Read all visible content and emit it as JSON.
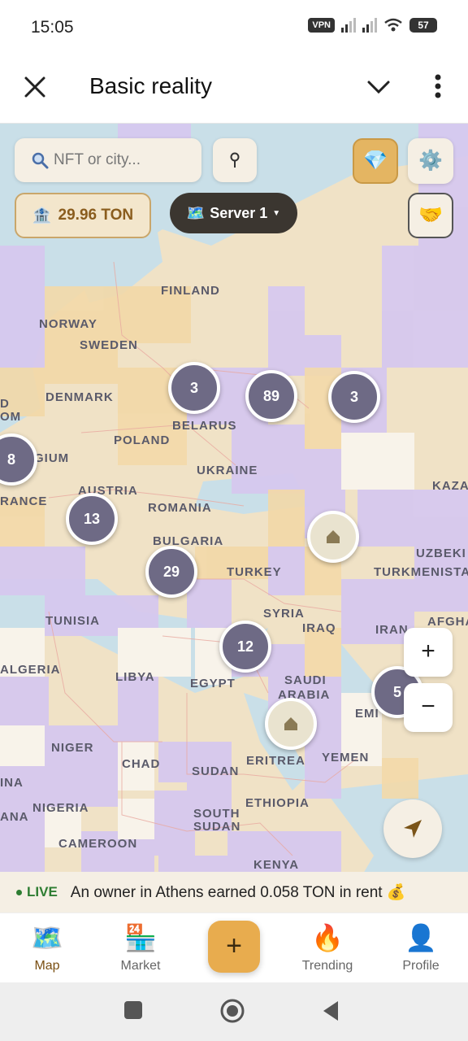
{
  "status_bar": {
    "time": "15:05",
    "vpn": "VPN",
    "battery": "57"
  },
  "app_bar": {
    "title": "Basic reality"
  },
  "map": {
    "search_placeholder": "NFT or city...",
    "balance": "29.96 TON",
    "server": "Server 1",
    "countries": [
      "FINLAND",
      "NORWAY",
      "SWEDEN",
      "DENMARK",
      "BELARUS",
      "POLAND",
      "UKRAINE",
      "AUSTRIA",
      "ROMANIA",
      "BULGARIA",
      "TURKEY",
      "TUNISIA",
      "SYRIA",
      "IRAQ",
      "IRAN",
      "ALGERIA",
      "LIBYA",
      "EGYPT",
      "SAUDI",
      "ARABIA",
      "NIGER",
      "CHAD",
      "SUDAN",
      "ERITREA",
      "YEMEN",
      "NIGERIA",
      "SOUTH",
      "SUDAN",
      "ETHIOPIA",
      "CAMEROON",
      "KENYA",
      "KAZA",
      "UZBEKI",
      "TURKMENISTA",
      "AFGHA",
      "EMI",
      "RANCE",
      "GIUM",
      "D",
      "OM",
      "INA",
      "ANA"
    ],
    "clusters": [
      "3",
      "89",
      "3",
      "8",
      "13",
      "29",
      "12",
      "5"
    ],
    "zoom_in": "+",
    "zoom_out": "−"
  },
  "ticker": {
    "live": "LIVE",
    "message": "An owner in Athens earned 0.058 TON in rent 💰"
  },
  "nav": {
    "items": [
      {
        "label": "Map",
        "icon": "🗺️"
      },
      {
        "label": "Market",
        "icon": "🏪"
      },
      {
        "label": "Trending",
        "icon": "🔥"
      },
      {
        "label": "Profile",
        "icon": "👤"
      }
    ],
    "fab": "+"
  },
  "colors": {
    "owned": "#d4c6ee",
    "land": "#f0deb8",
    "water": "#b8d8ea",
    "accent": "#e8ac4e"
  }
}
